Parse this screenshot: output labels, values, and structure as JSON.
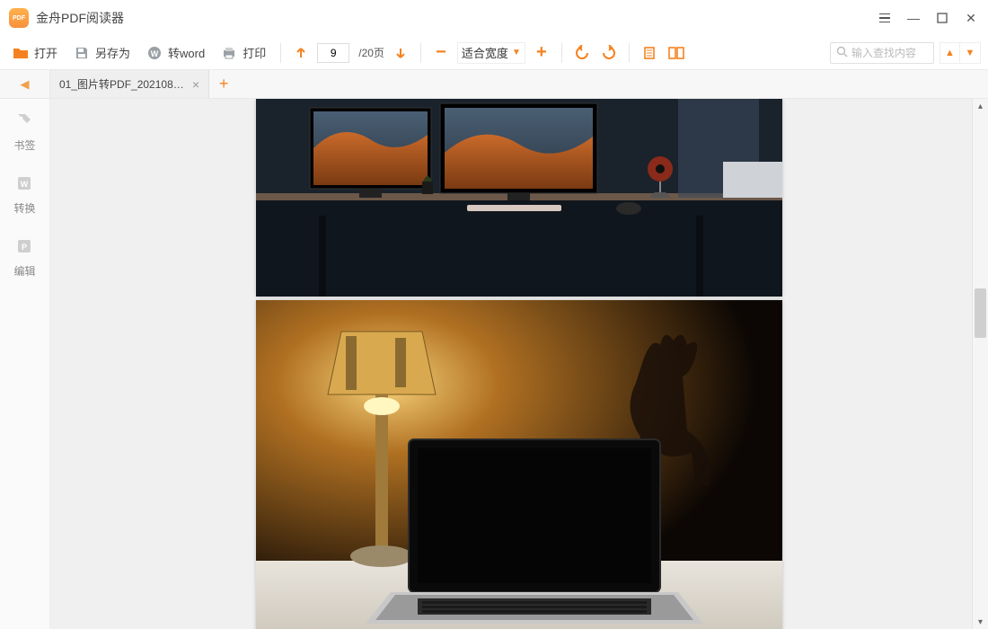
{
  "app": {
    "title": "金舟PDF阅读器"
  },
  "toolbar": {
    "open": "打开",
    "save_as": "另存为",
    "to_word": "转word",
    "print": "打印",
    "page_current": "9",
    "page_total": "/20页",
    "zoom_mode": "适合宽度"
  },
  "search": {
    "placeholder": "输入查找内容"
  },
  "tabs": {
    "items": [
      {
        "label": "01_图片转PDF_2021080..."
      }
    ]
  },
  "sidebar": {
    "bookmark": "书签",
    "convert": "转换",
    "edit": "编辑"
  },
  "colors": {
    "accent": "#f58220"
  }
}
